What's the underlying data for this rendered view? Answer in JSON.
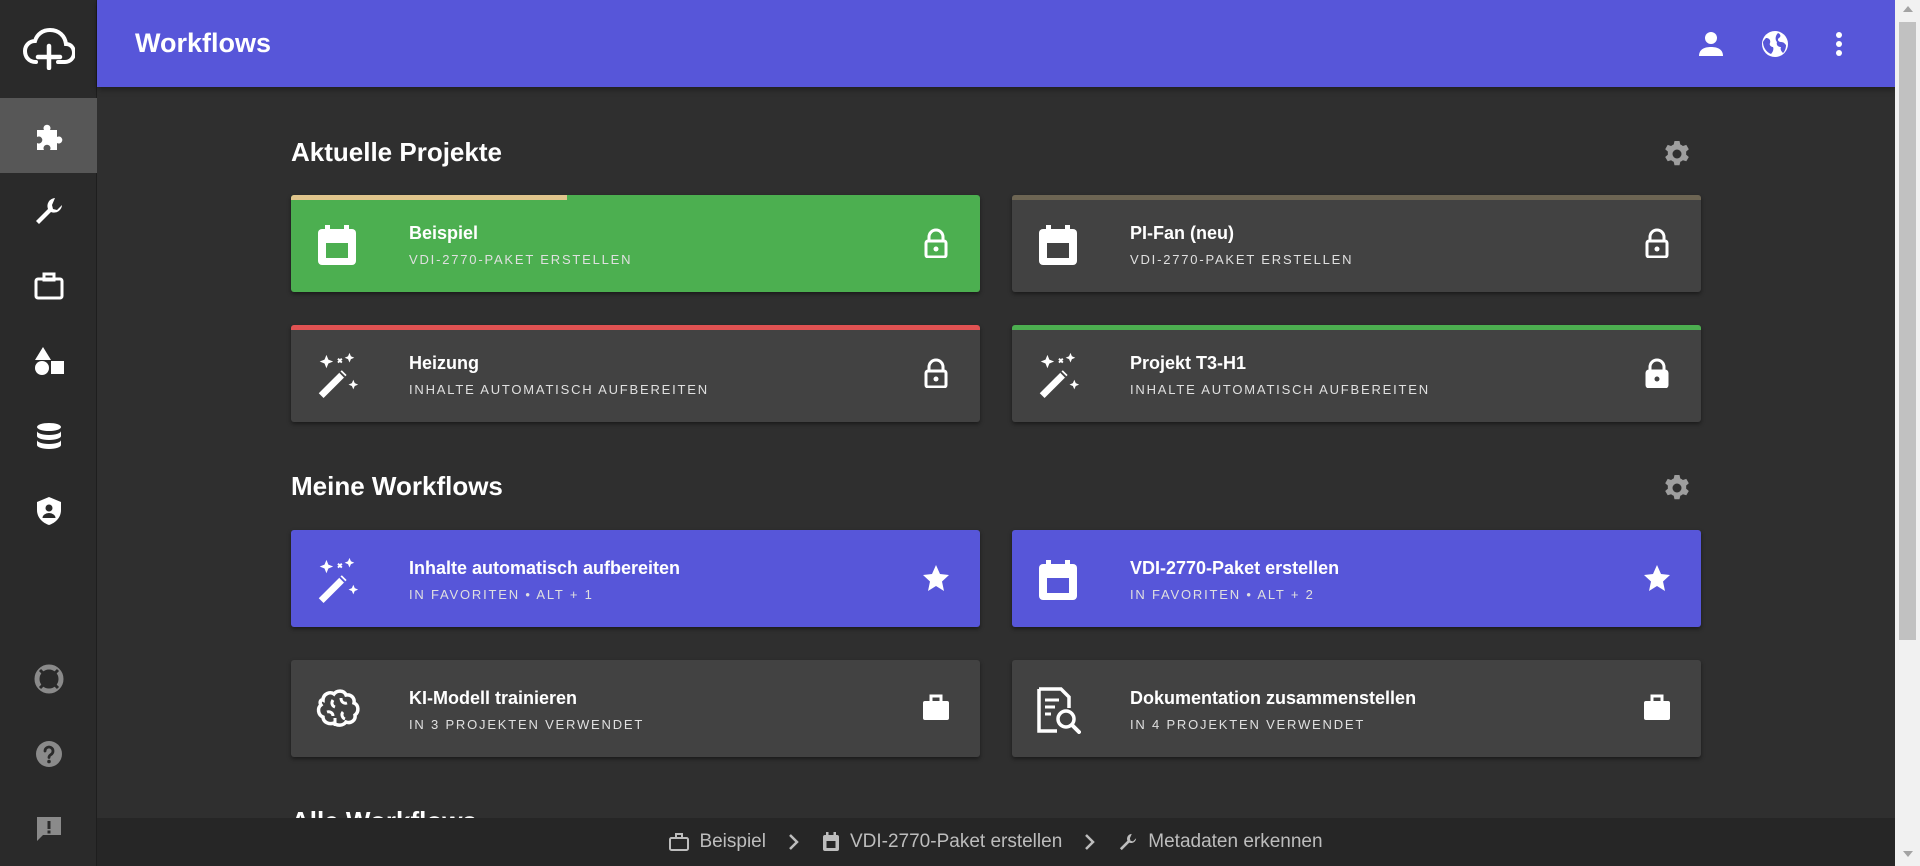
{
  "header": {
    "title": "Workflows"
  },
  "sidebar": {
    "items": [
      {
        "name": "workflows",
        "icon": "puzzle-icon",
        "active": true
      },
      {
        "name": "tools",
        "icon": "wrench-icon"
      },
      {
        "name": "projects",
        "icon": "briefcase-icon"
      },
      {
        "name": "shapes",
        "icon": "shapes-icon"
      },
      {
        "name": "database",
        "icon": "database-icon"
      },
      {
        "name": "security",
        "icon": "shield-icon"
      },
      {
        "name": "support",
        "icon": "lifebuoy-icon"
      },
      {
        "name": "help",
        "icon": "help-icon"
      },
      {
        "name": "feedback",
        "icon": "feedback-icon"
      }
    ]
  },
  "sections": {
    "recent": {
      "title": "Aktuelle Projekte"
    },
    "mine": {
      "title": "Meine Workflows"
    },
    "all": {
      "title": "Alle Workflows"
    }
  },
  "recent_cards": [
    {
      "name": "Beispiel",
      "sub": "VDI-2770-Paket erstellen",
      "icon": "calendar-icon",
      "action": "lock-icon",
      "bar_color": "#e0c58c",
      "bar_fill": 0.4
    },
    {
      "name": "PI-Fan (neu)",
      "sub": "VDI-2770-Paket erstellen",
      "icon": "calendar-icon",
      "action": "lock-icon",
      "bar_color": "#6d6553",
      "bar_fill": 1.0
    },
    {
      "name": "Heizung",
      "sub": "Inhalte automatisch aufbereiten",
      "icon": "magic-wand-icon",
      "action": "lock-icon",
      "bar_color": "#e05252",
      "bar_fill": 1.0
    },
    {
      "name": "Projekt T3-H1",
      "sub": "Inhalte automatisch aufbereiten",
      "icon": "magic-wand-icon",
      "action": "lock-icon",
      "bar_color": "#4caf50",
      "bar_fill": 1.0
    }
  ],
  "my_cards": [
    {
      "name": "Inhalte automatisch aufbereiten",
      "sub": "In Favoriten • Alt + 1",
      "icon": "magic-wand-icon",
      "action": "star-icon"
    },
    {
      "name": "VDI-2770-Paket erstellen",
      "sub": "In Favoriten • Alt + 2",
      "icon": "calendar-icon",
      "action": "star-icon"
    },
    {
      "name": "KI-Modell trainieren",
      "sub": "In 3 Projekten verwendet",
      "icon": "brain-icon",
      "action": "briefcase-icon"
    },
    {
      "name": "Dokumentation zusammenstellen",
      "sub": "In 4 Projekten verwendet",
      "icon": "document-search-icon",
      "action": "briefcase-icon"
    }
  ],
  "breadcrumb": {
    "items": [
      {
        "label": "Beispiel",
        "icon": "briefcase-icon"
      },
      {
        "label": "VDI-2770-Paket erstellen",
        "icon": "calendar-icon"
      },
      {
        "label": "Metadaten erkennen",
        "icon": "wrench-icon"
      }
    ]
  },
  "colors": {
    "accent": "#5756d9",
    "green": "#4caf50",
    "card": "#424242",
    "background": "#2f2f2f"
  }
}
